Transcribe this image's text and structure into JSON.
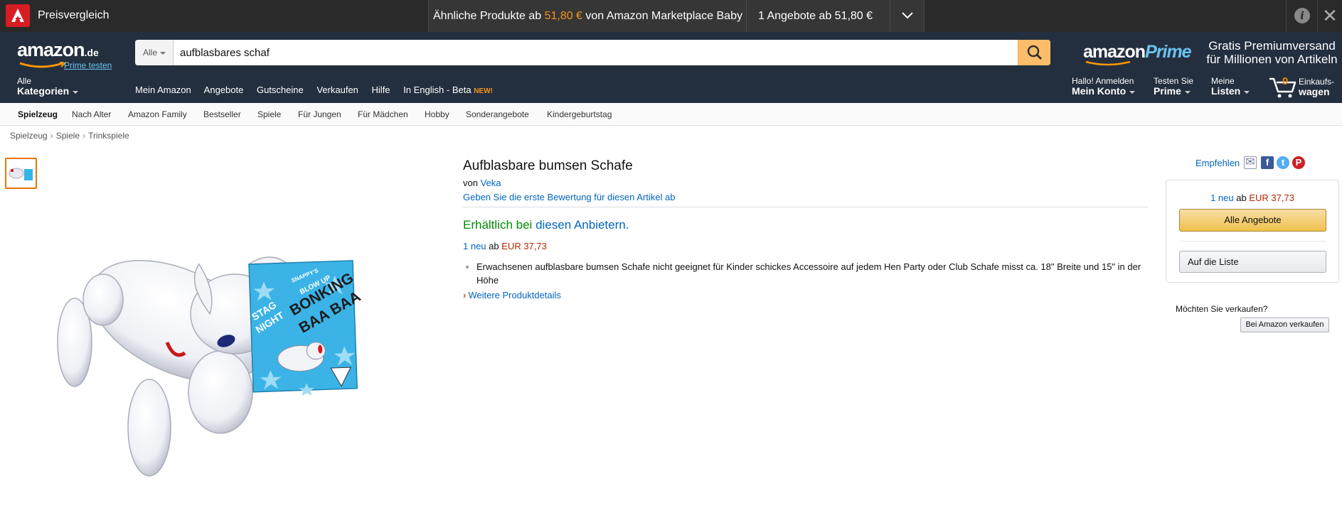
{
  "avira": {
    "brand": "Preisvergleich",
    "similar_prefix": "Ähnliche Produkte ab",
    "similar_price": "51,80 €",
    "similar_suffix": "von Amazon Marketplace Baby a...",
    "offers": "1 Angebote ab 51,80 €",
    "info_glyph": "i",
    "close_glyph": "✕",
    "accent": "#d61d24"
  },
  "header": {
    "logo_word": "amazon",
    "logo_tld": ".de",
    "prime_try": "Prime testen",
    "search_category": "Alle",
    "search_value": "aufblasbares schaf",
    "prime_logo_amazon": "amazon",
    "prime_logo_prime": "Prime",
    "promo_line1": "Gratis Premiumversand",
    "promo_line2": "für Millionen von Artikeln",
    "all_label": "Alle",
    "all_bold": "Kategorien",
    "links": [
      "Mein Amazon",
      "Angebote",
      "Gutscheine",
      "Verkaufen",
      "Hilfe",
      "In English - Beta"
    ],
    "new_badge": "NEW!",
    "account_top": "Hallo! Anmelden",
    "account_bold": "Mein Konto",
    "prime_top": "Testen Sie",
    "prime_bold": "Prime",
    "lists_top": "Meine",
    "lists_bold": "Listen",
    "cart_count": "0",
    "cart_top": "Einkaufs-",
    "cart_bold": "wagen",
    "nav_bg": "#232f3e",
    "search_btn_color": "#febd69"
  },
  "subnav": [
    "Spielzeug",
    "Nach Alter",
    "Amazon Family",
    "Bestseller",
    "Spiele",
    "Für Jungen",
    "Für Mädchen",
    "Hobby",
    "Sonderangebote",
    "Kindergeburtstag"
  ],
  "breadcrumb": [
    "Spielzeug",
    "Spiele",
    "Trinkspiele"
  ],
  "breadcrumb_sep": "›",
  "product": {
    "title": "Aufblasbare bumsen Schafe",
    "by_label": "von",
    "brand": "Veka",
    "review_link": "Geben Sie die erste Bewertung für diesen Artikel ab",
    "avail_green": "Erhältlich bei",
    "avail_link": "diesen Anbietern.",
    "offer_link": "1 neu",
    "offer_mid": "ab",
    "offer_price": "EUR 37,73",
    "bullets": [
      "Erwachsenen aufblasbare bumsen Schafe nicht geeignet für Kinder schickes Accessoire auf jedem Hen Party oder Club Schafe misst ca. 18\" Breite und 15\" in der Höhe"
    ],
    "more_link": "Weitere Produktdetails",
    "more_arrow": "›",
    "box_brand": "SNAPPY'S",
    "box_blowup": "BLOW UP",
    "box_name1": "BONKING",
    "box_name2": "BAA BAA",
    "box_stag": "STAG",
    "box_night": "NIGHT"
  },
  "share": {
    "label": "Empfehlen",
    "email_icon": "✉",
    "fb_glyph": "f",
    "tw_glyph": "t",
    "pin_glyph": "P"
  },
  "buybox": {
    "offer_link": "1 neu",
    "offer_mid": "ab",
    "offer_price": "EUR 37,73",
    "all_offers": "Alle Angebote",
    "add_list": "Auf die Liste"
  },
  "sell": {
    "question": "Möchten Sie verkaufen?",
    "button": "Bei Amazon verkaufen"
  }
}
